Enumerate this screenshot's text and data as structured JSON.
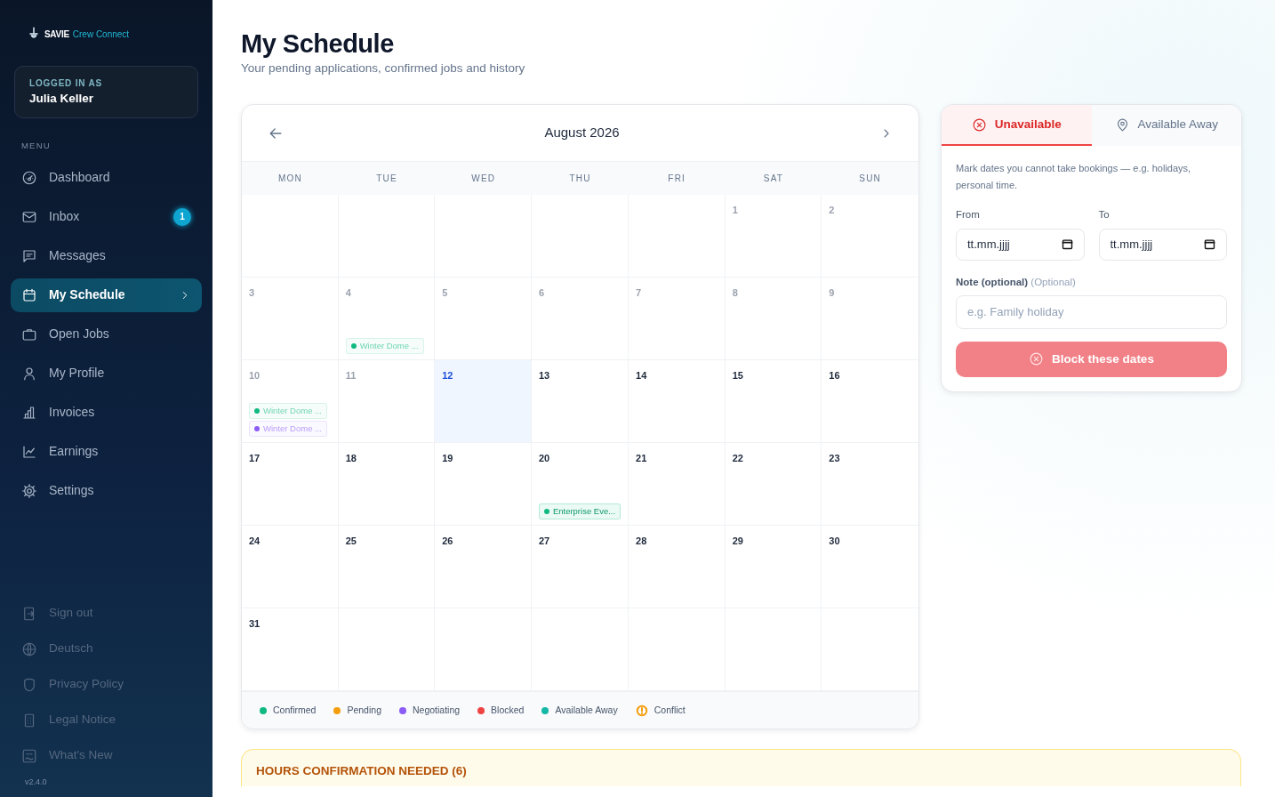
{
  "sidebar": {
    "logo": {
      "brand": "SAVIE",
      "product": "Crew Connect"
    },
    "user": {
      "label": "LOGGED IN AS",
      "name": "Julia Keller"
    },
    "menu_heading": "MENU",
    "items": [
      {
        "label": "Dashboard",
        "selected": false
      },
      {
        "label": "Inbox",
        "badge": "1",
        "selected": false
      },
      {
        "label": "Messages",
        "selected": false
      },
      {
        "label": "My Schedule",
        "selected": true
      },
      {
        "label": "Open Jobs",
        "selected": false
      },
      {
        "label": "My Profile",
        "selected": false
      },
      {
        "label": "Invoices",
        "selected": false
      },
      {
        "label": "Earnings",
        "selected": false
      },
      {
        "label": "Settings",
        "selected": false
      }
    ],
    "footer_items": [
      {
        "label": "Sign out"
      },
      {
        "label": "Deutsch"
      },
      {
        "label": "Privacy Policy"
      },
      {
        "label": "Legal Notice"
      },
      {
        "label": "What's New"
      }
    ],
    "version": "v2.4.0"
  },
  "page": {
    "title": "My Schedule",
    "subtitle": "Your pending applications, confirmed jobs and history"
  },
  "calendar": {
    "month": "August 2026",
    "weekdays": [
      "MON",
      "TUE",
      "WED",
      "THU",
      "FRI",
      "SAT",
      "SUN"
    ],
    "weeks": [
      [
        {
          "kind": "blank"
        },
        {
          "kind": "blank"
        },
        {
          "kind": "blank"
        },
        {
          "kind": "blank"
        },
        {
          "kind": "blank"
        },
        {
          "kind": "day",
          "day": "1",
          "past": true,
          "today": false
        },
        {
          "kind": "day",
          "day": "2",
          "past": true,
          "today": false
        }
      ],
      [
        {
          "kind": "day",
          "day": "3",
          "past": true,
          "today": false
        },
        {
          "kind": "day",
          "day": "4",
          "past": true,
          "today": false,
          "events": [
            {
              "label": "Winter Dome ...",
              "color": "#10b981"
            }
          ]
        },
        {
          "kind": "day",
          "day": "5",
          "past": true,
          "today": false
        },
        {
          "kind": "day",
          "day": "6",
          "past": true,
          "today": false
        },
        {
          "kind": "day",
          "day": "7",
          "past": true,
          "today": false
        },
        {
          "kind": "day",
          "day": "8",
          "past": true,
          "today": false
        },
        {
          "kind": "day",
          "day": "9",
          "past": true,
          "today": false
        }
      ],
      [
        {
          "kind": "day",
          "day": "10",
          "past": true,
          "today": false,
          "events": [
            {
              "label": "Winter Dome ...",
              "color": "#10b981"
            },
            {
              "label": "Winter Dome ...",
              "color": "#8b5cf6"
            }
          ]
        },
        {
          "kind": "day",
          "day": "11",
          "past": true,
          "today": false
        },
        {
          "kind": "day",
          "day": "12",
          "past": false,
          "today": true
        },
        {
          "kind": "day",
          "day": "13",
          "past": false,
          "today": false
        },
        {
          "kind": "day",
          "day": "14",
          "past": false,
          "today": false
        },
        {
          "kind": "day",
          "day": "15",
          "past": false,
          "today": false
        },
        {
          "kind": "day",
          "day": "16",
          "past": false,
          "today": false
        }
      ],
      [
        {
          "kind": "day",
          "day": "17",
          "past": false,
          "today": false
        },
        {
          "kind": "day",
          "day": "18",
          "past": false,
          "today": false
        },
        {
          "kind": "day",
          "day": "19",
          "past": false,
          "today": false
        },
        {
          "kind": "day",
          "day": "20",
          "past": false,
          "today": false,
          "events": [
            {
              "label": "Enterprise Eve...",
              "color": "#10b981"
            }
          ]
        },
        {
          "kind": "day",
          "day": "21",
          "past": false,
          "today": false
        },
        {
          "kind": "day",
          "day": "22",
          "past": false,
          "today": false
        },
        {
          "kind": "day",
          "day": "23",
          "past": false,
          "today": false
        }
      ],
      [
        {
          "kind": "day",
          "day": "24",
          "past": false,
          "today": false
        },
        {
          "kind": "day",
          "day": "25",
          "past": false,
          "today": false
        },
        {
          "kind": "day",
          "day": "26",
          "past": false,
          "today": false
        },
        {
          "kind": "day",
          "day": "27",
          "past": false,
          "today": false
        },
        {
          "kind": "day",
          "day": "28",
          "past": false,
          "today": false
        },
        {
          "kind": "day",
          "day": "29",
          "past": false,
          "today": false
        },
        {
          "kind": "day",
          "day": "30",
          "past": false,
          "today": false
        }
      ],
      [
        {
          "kind": "day",
          "day": "31",
          "past": false,
          "today": false
        },
        {
          "kind": "blank"
        },
        {
          "kind": "blank"
        },
        {
          "kind": "blank"
        },
        {
          "kind": "blank"
        },
        {
          "kind": "blank"
        },
        {
          "kind": "blank"
        }
      ]
    ],
    "legend": [
      {
        "kind": "dot",
        "label": "Confirmed",
        "color": "#10b981"
      },
      {
        "kind": "dot",
        "label": "Pending",
        "color": "#f59e0b"
      },
      {
        "kind": "dot",
        "label": "Negotiating",
        "color": "#8b5cf6"
      },
      {
        "kind": "dot",
        "label": "Blocked",
        "color": "#ef4444"
      },
      {
        "kind": "dot",
        "label": "Available Away",
        "color": "#14b8a6"
      },
      {
        "kind": "warning",
        "label": "Conflict",
        "color": "#f59e0b"
      }
    ]
  },
  "availability": {
    "tabs": [
      {
        "label": "Unavailable",
        "selected": true
      },
      {
        "label": "Available Away",
        "selected": false
      }
    ],
    "description": "Mark dates you cannot take bookings — e.g. holidays, personal time.",
    "from": {
      "label": "From",
      "placeholder": "tt.mm.jjjj"
    },
    "to": {
      "label": "To",
      "placeholder": "tt.mm.jjjj"
    },
    "note": {
      "label": "Note (optional)",
      "hint": "(Optional)",
      "placeholder": "e.g. Family holiday"
    },
    "submit": {
      "label": "Block these dates",
      "disabled": true
    }
  },
  "hours": {
    "title": "HOURS CONFIRMATION NEEDED (6)"
  }
}
